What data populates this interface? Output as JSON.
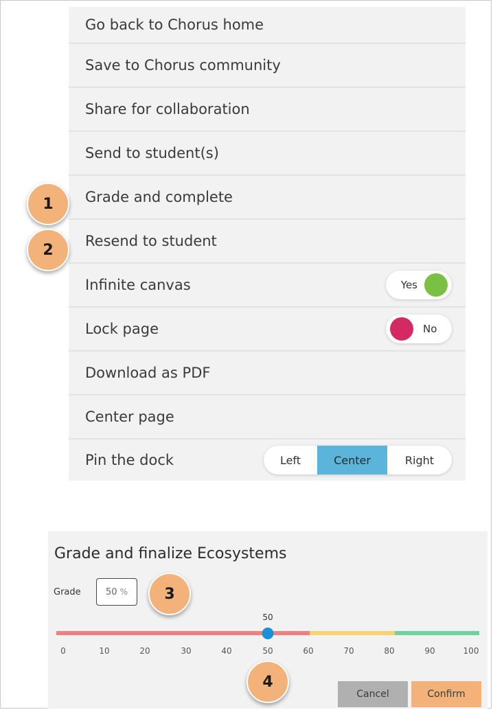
{
  "menu": {
    "items": [
      {
        "label": "Go back to Chorus home"
      },
      {
        "label": "Save to Chorus community"
      },
      {
        "label": "Share for collaboration"
      },
      {
        "label": "Send to student(s)"
      },
      {
        "label": "Grade and complete"
      },
      {
        "label": "Resend to student"
      },
      {
        "label": "Infinite canvas",
        "toggle": "Yes"
      },
      {
        "label": "Lock page",
        "toggle": "No"
      },
      {
        "label": "Download as PDF"
      },
      {
        "label": "Center page"
      },
      {
        "label": "Pin the dock",
        "options": [
          "Left",
          "Center",
          "Right"
        ],
        "selected": "Center"
      }
    ]
  },
  "callouts": [
    "1",
    "2",
    "3",
    "4"
  ],
  "grade_panel": {
    "title": "Grade and finalize Ecosystems",
    "grade_label": "Grade",
    "grade_value": "50",
    "grade_unit": "%",
    "slider_value": "50",
    "ticks": [
      "0",
      "10",
      "20",
      "30",
      "40",
      "50",
      "60",
      "70",
      "80",
      "90",
      "100"
    ],
    "cancel_label": "Cancel",
    "confirm_label": "Confirm"
  },
  "colors": {
    "accent_orange": "#f2b27a",
    "toggle_yes": "#7ac043",
    "toggle_no": "#d42a64",
    "segment_selected": "#5bb4d9",
    "slider_red": "#f08080",
    "slider_yellow": "#f9d36e",
    "slider_green": "#6fd3a0",
    "slider_thumb": "#1c8fd8"
  }
}
